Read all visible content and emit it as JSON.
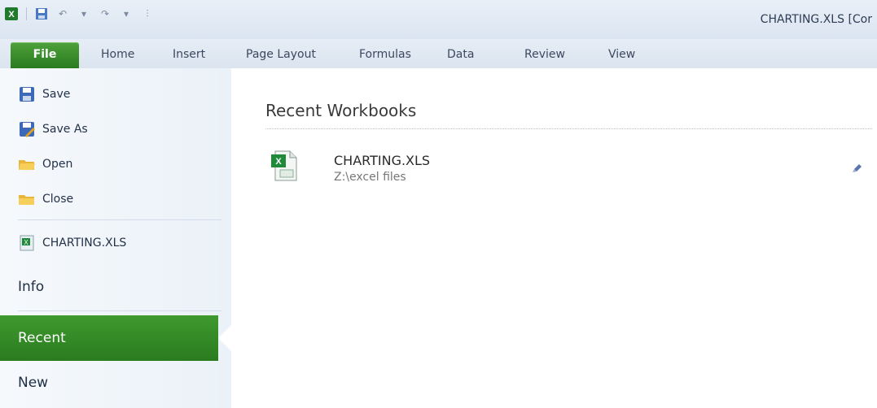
{
  "window": {
    "title": "CHARTING.XLS [Cor"
  },
  "ribbon": {
    "tabs": [
      {
        "label": "File"
      },
      {
        "label": "Home"
      },
      {
        "label": "Insert"
      },
      {
        "label": "Page Layout"
      },
      {
        "label": "Formulas"
      },
      {
        "label": "Data"
      },
      {
        "label": "Review"
      },
      {
        "label": "View"
      }
    ]
  },
  "backstage": {
    "commands": [
      {
        "label": "Save",
        "icon": "save-icon"
      },
      {
        "label": "Save As",
        "icon": "save-as-icon"
      },
      {
        "label": "Open",
        "icon": "open-folder-icon"
      },
      {
        "label": "Close",
        "icon": "close-folder-icon"
      }
    ],
    "open_file": {
      "label": "CHARTING.XLS",
      "icon": "excel-file-icon"
    },
    "info": "Info",
    "recent": "Recent",
    "new": "New"
  },
  "main": {
    "section_title": "Recent Workbooks",
    "recent_files": [
      {
        "name": "CHARTING.XLS",
        "path": "Z:\\excel files"
      }
    ]
  },
  "colors": {
    "file_tab": "#2a7a1f",
    "recent_active": "#3f9a2f",
    "accent": "#4ea13b"
  }
}
